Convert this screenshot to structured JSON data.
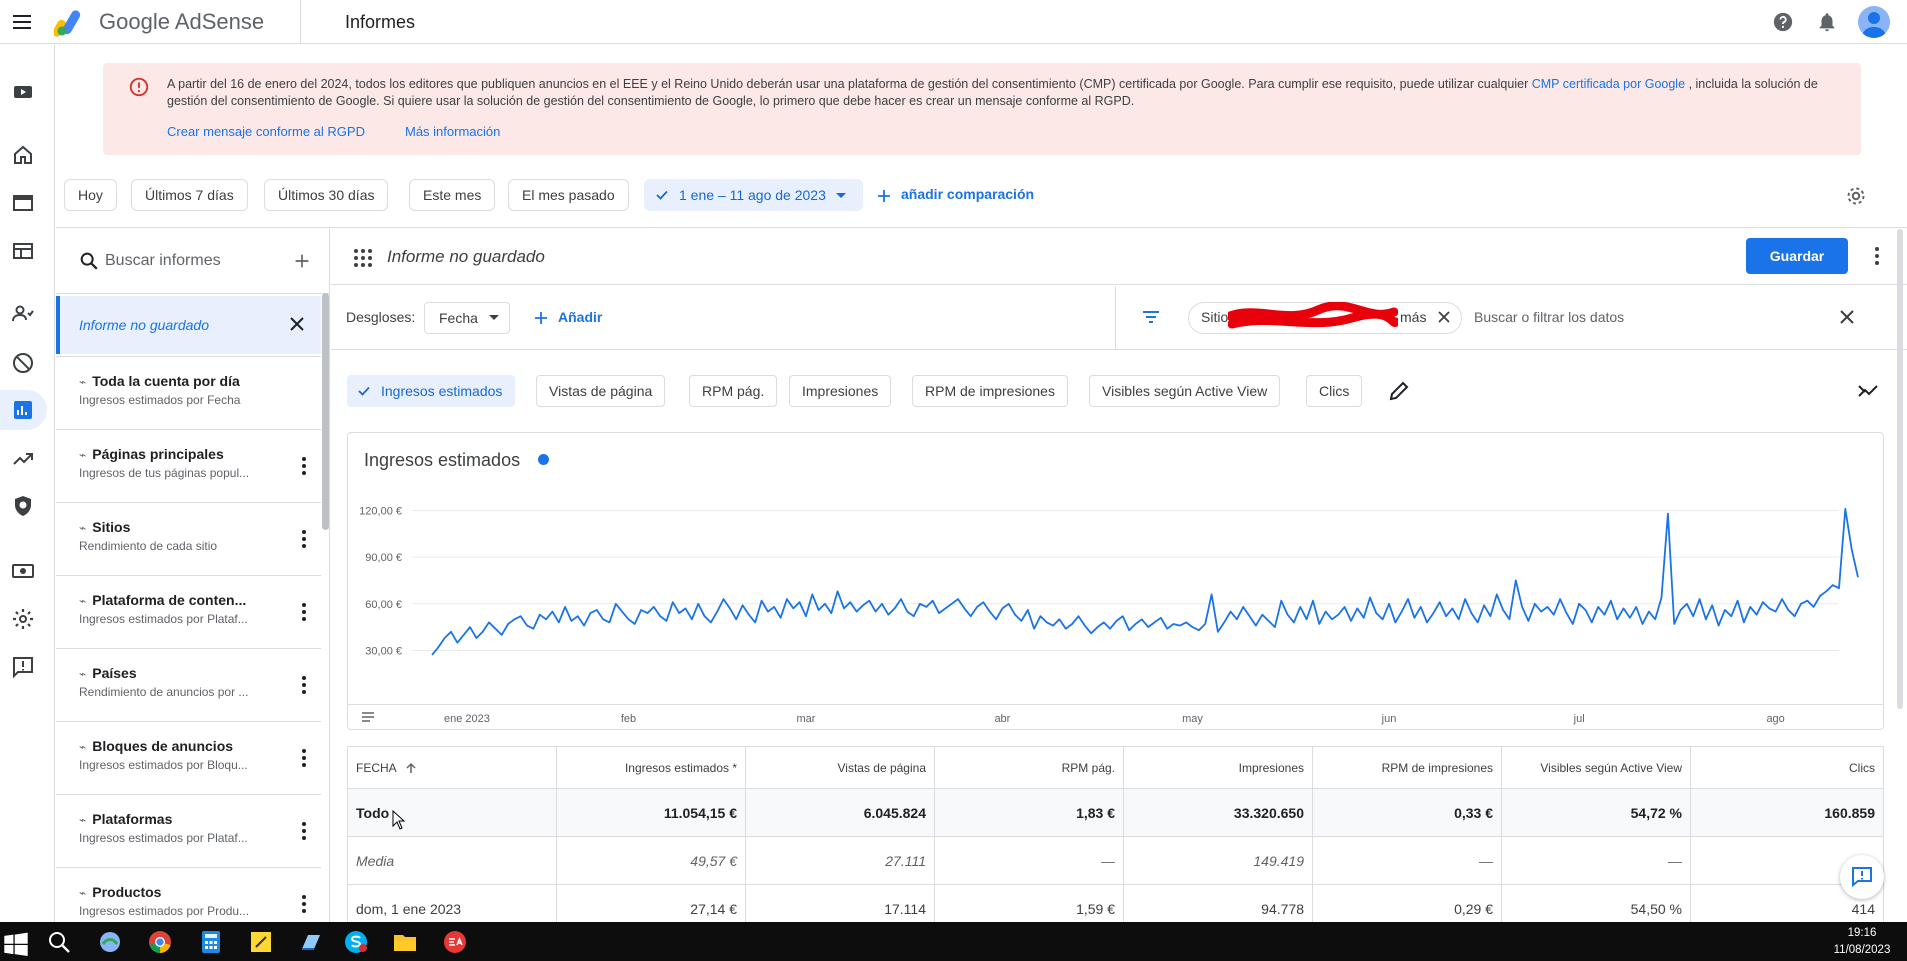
{
  "header": {
    "brand": "Google AdSense",
    "page_title": "Informes"
  },
  "banner": {
    "text_before": "A partir del 16 de enero del 2024, todos los editores que publiquen anuncios en el EEE y el Reino Unido deberán usar una plataforma de gestión del consentimiento (CMP) certificada por Google. Para cumplir ese requisito, puede utilizar cualquier ",
    "link_text": "CMP certificada por Google",
    "text_after": " , incluida la solución de gestión del consentimiento de Google. Si quiere usar la solución de gestión del consentimiento de Google, lo primero que debe hacer es crear un mensaje conforme al RGPD.",
    "action_create": "Crear mensaje conforme al RGPD",
    "action_more": "Más información"
  },
  "dates": {
    "chips": [
      "Hoy",
      "Últimos 7 días",
      "Últimos 30 días",
      "Este mes",
      "El mes pasado"
    ],
    "selected_range": "1 ene – 11 ago de 2023",
    "add_comparison": "añadir comparación"
  },
  "sidebar": {
    "search_placeholder": "Buscar informes",
    "active_report": "Informe no guardado",
    "reports": [
      {
        "title": "Toda la cuenta por día",
        "subtitle": "Ingresos estimados por Fecha"
      },
      {
        "title": "Páginas principales",
        "subtitle": "Ingresos de tus páginas popul..."
      },
      {
        "title": "Sitios",
        "subtitle": "Rendimiento de cada sitio"
      },
      {
        "title": "Plataforma de conten...",
        "subtitle": "Ingresos estimados por Plataf..."
      },
      {
        "title": "Países",
        "subtitle": "Rendimiento de anuncios por ..."
      },
      {
        "title": "Bloques de anuncios",
        "subtitle": "Ingresos estimados por Bloqu..."
      },
      {
        "title": "Plataformas",
        "subtitle": "Ingresos estimados por Plataf..."
      },
      {
        "title": "Productos",
        "subtitle": "Ingresos estimados por Produ..."
      }
    ]
  },
  "report": {
    "title": "Informe no guardado",
    "save": "Guardar",
    "breakdowns_label": "Desgloses:",
    "breakdown_value": "Fecha",
    "add": "Añadir",
    "filter_chip_prefix": "Sitio",
    "filter_chip_suffix": "más",
    "filter_placeholder": "Buscar o filtrar los datos",
    "metrics": [
      "Ingresos estimados",
      "Vistas de página",
      "RPM pág.",
      "Impresiones",
      "RPM de impresiones",
      "Visibles según Active View",
      "Clics"
    ]
  },
  "chart_data": {
    "type": "line",
    "title": "Ingresos estimados",
    "series_color": "#1a73e8",
    "y_ticks": [
      "120,00 €",
      "90,00 €",
      "60,00 €",
      "30,00 €"
    ],
    "y_tick_values": [
      120,
      90,
      60,
      30
    ],
    "ylim": [
      20,
      128
    ],
    "x_tick_labels": [
      "ene 2023",
      "feb",
      "mar",
      "abr",
      "may",
      "jun",
      "jul",
      "ago"
    ],
    "x_tick_days": [
      0,
      31,
      59,
      90,
      120,
      151,
      181,
      212
    ],
    "x_days_range": [
      0,
      222
    ],
    "values": [
      27.14,
      32,
      38,
      42,
      35,
      40,
      45,
      38,
      42,
      48,
      44,
      40,
      47,
      50,
      52,
      46,
      44,
      53,
      50,
      55,
      48,
      58,
      49,
      52,
      46,
      54,
      56,
      50,
      48,
      60,
      55,
      50,
      47,
      56,
      54,
      58,
      52,
      49,
      61,
      54,
      57,
      50,
      60,
      52,
      48,
      55,
      63,
      57,
      50,
      59,
      53,
      48,
      62,
      55,
      58,
      51,
      63,
      57,
      61,
      52,
      66,
      56,
      60,
      54,
      68,
      57,
      61,
      55,
      59,
      62,
      55,
      60,
      53,
      57,
      63,
      55,
      52,
      60,
      58,
      62,
      54,
      57,
      60,
      63,
      57,
      52,
      58,
      61,
      55,
      50,
      57,
      60,
      53,
      49,
      56,
      44,
      52,
      48,
      46,
      50,
      44,
      47,
      52,
      46,
      41,
      45,
      48,
      44,
      49,
      52,
      43,
      47,
      50,
      45,
      48,
      51,
      44,
      47,
      46,
      48,
      45,
      43,
      47,
      66,
      42,
      48,
      55,
      50,
      58,
      52,
      46,
      53,
      49,
      45,
      62,
      53,
      48,
      58,
      50,
      62,
      47,
      55,
      50,
      53,
      58,
      49,
      57,
      51,
      64,
      54,
      50,
      60,
      48,
      55,
      63,
      51,
      58,
      48,
      54,
      61,
      52,
      57,
      50,
      63,
      54,
      48,
      59,
      52,
      66,
      56,
      50,
      75,
      58,
      49,
      60,
      55,
      58,
      53,
      63,
      54,
      47,
      60,
      56,
      48,
      58,
      53,
      62,
      50,
      57,
      51,
      58,
      47,
      55,
      50,
      64,
      118,
      47,
      56,
      60,
      52,
      63,
      50,
      59,
      46,
      56,
      52,
      62,
      48,
      58,
      53,
      61,
      57,
      55,
      63,
      56,
      52,
      60,
      62,
      58,
      65,
      68,
      72,
      70,
      121,
      95,
      77
    ]
  },
  "table": {
    "headers": [
      "FECHA",
      "Ingresos estimados *",
      "Vistas de página",
      "RPM pág.",
      "Impresiones",
      "RPM de impresiones",
      "Visibles según Active View",
      "Clics"
    ],
    "total": [
      "Todo",
      "11.054,15 €",
      "6.045.824",
      "1,83 €",
      "33.320.650",
      "0,33 €",
      "54,72 %",
      "160.859"
    ],
    "average": [
      "Media",
      "49,57 €",
      "27.111",
      "—",
      "149.419",
      "—",
      "—",
      ""
    ],
    "rows": [
      [
        "dom, 1 ene 2023",
        "27,14 €",
        "17.114",
        "1,59 €",
        "94.778",
        "0,29 €",
        "54,50 %",
        "414"
      ]
    ]
  },
  "taskbar": {
    "time": "19:16",
    "date": "11/08/2023"
  }
}
